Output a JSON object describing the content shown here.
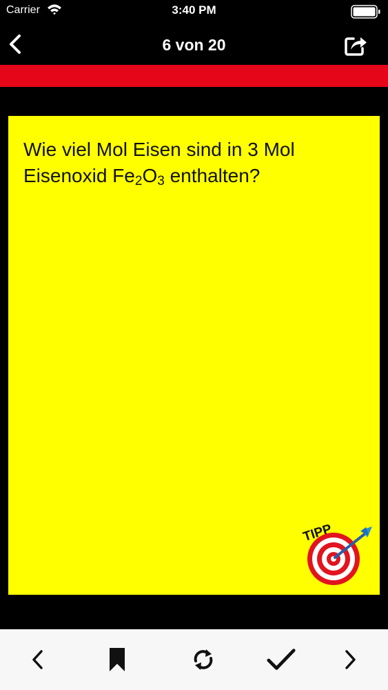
{
  "status_bar": {
    "carrier": "Carrier",
    "time": "3:40 PM"
  },
  "nav": {
    "title": "6 von 20",
    "back_icon": "chevron-left-icon",
    "share_icon": "share-icon"
  },
  "card": {
    "question_part1": "Wie viel Mol Eisen sind in 3 Mol Eisenoxid Fe",
    "sub1": "2",
    "mid": "O",
    "sub2": "3",
    "question_part2": " enthalten?",
    "tipp_label": "TIPP",
    "background_color": "#ffff00"
  },
  "toolbar": {
    "items": [
      "previous-icon",
      "bookmark-icon",
      "flip-icon",
      "checkmark-icon",
      "next-icon"
    ]
  },
  "colors": {
    "accent_red": "#e6061a",
    "card_yellow": "#ffff00",
    "toolbar_bg": "#f7f7f7"
  }
}
